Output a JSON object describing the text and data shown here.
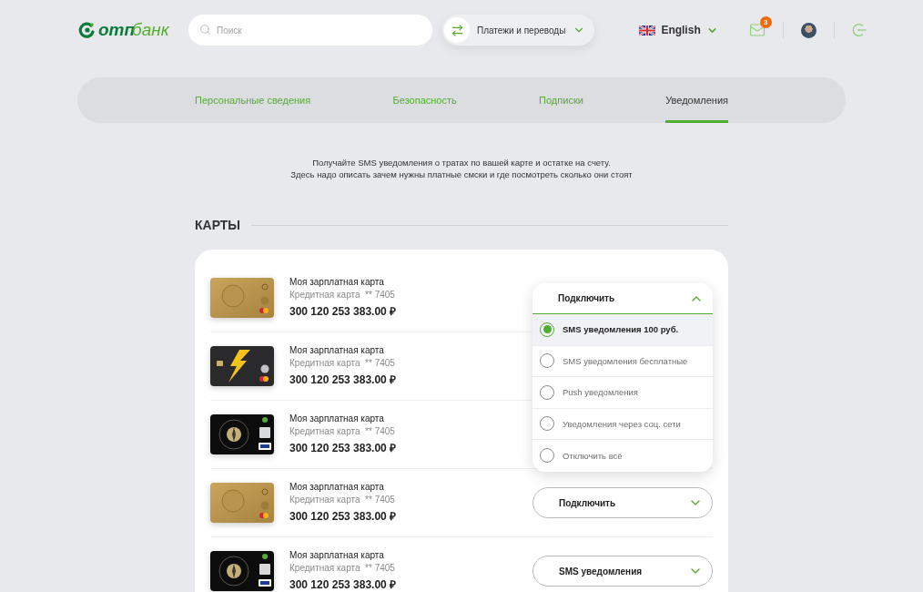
{
  "header": {
    "logo": {
      "bold": "отп",
      "light": "банк"
    },
    "search": {
      "placeholder": "Поиск"
    },
    "payments_menu": {
      "label": "Платежи и переводы"
    },
    "language": {
      "label": "English"
    },
    "mail": {
      "badge": "3"
    }
  },
  "tabs": [
    {
      "label": "Персональные сведения",
      "selected": false
    },
    {
      "label": "Безопасность",
      "selected": false
    },
    {
      "label": "Подписки",
      "selected": false
    },
    {
      "label": "Уведомления",
      "selected": true
    }
  ],
  "intro": [
    "Получайте SMS уведомления о тратах по вашей карте и остатке на счету.",
    "Здесь надо описать зачем нужны платные смски и где посмотреть сколько они стоят"
  ],
  "section_title": "КАРТЫ",
  "cards": [
    {
      "kind": "gold",
      "name": "Моя зарплатная карта",
      "type": "Кредитная карта",
      "number": "** 7405",
      "balance": "300 120 253 383.00 ₽",
      "dropdown": {
        "value": "Подключить",
        "expanded": true,
        "options": [
          {
            "label": "SMS уведомления 100 руб.",
            "selected": true
          },
          {
            "label": "SMS уведомления бесплатные",
            "selected": false
          },
          {
            "label": "Push уведомления",
            "selected": false
          },
          {
            "label": "Уведомления через соц. сети",
            "selected": false
          },
          {
            "label": "Отключить всё",
            "selected": false
          }
        ]
      }
    },
    {
      "kind": "lightning",
      "name": "Моя зарплатная карта",
      "type": "Кредитная карта",
      "number": "** 7405",
      "balance": "300 120 253 383.00 ₽"
    },
    {
      "kind": "compass",
      "name": "Моя зарплатная карта",
      "type": "Кредитная карта",
      "number": "** 7405",
      "balance": "300 120 253 383.00 ₽"
    },
    {
      "kind": "gold",
      "name": "Моя зарплатная карта",
      "type": "Кредитная карта",
      "number": "** 7405",
      "balance": "300 120 253 383.00 ₽",
      "dropdown": {
        "value": "Подключить",
        "expanded": false
      }
    },
    {
      "kind": "compass",
      "name": "Моя зарплатная карта",
      "type": "Кредитная карта",
      "number": "** 7405",
      "balance": "300 120 253 383.00 ₽",
      "dropdown": {
        "value": "SMS уведомления",
        "expanded": false
      }
    }
  ]
}
